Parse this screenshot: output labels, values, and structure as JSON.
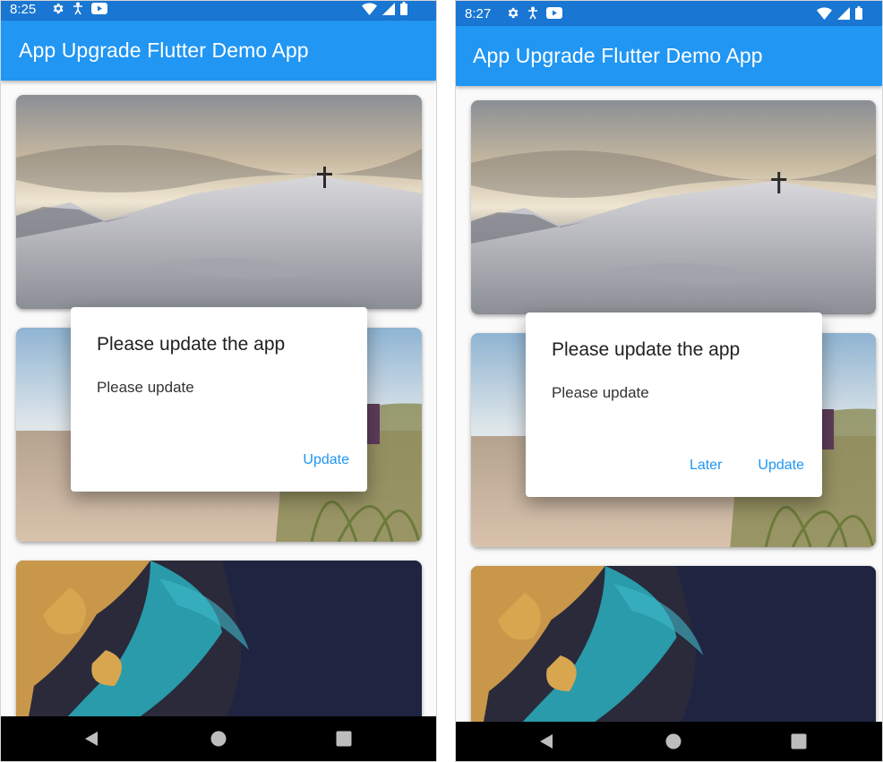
{
  "screens": [
    {
      "status": {
        "time": "8:25"
      },
      "app_bar": {
        "title": "App Upgrade Flutter Demo App"
      },
      "cards": [
        {
          "image": "snowy-hill-with-cross-photo"
        },
        {
          "image": "beach-dunes-photo"
        },
        {
          "image": "aerial-coastline-photo"
        }
      ],
      "dialog": {
        "title": "Please update the app",
        "body": "Please update",
        "buttons": {
          "update": "Update"
        }
      }
    },
    {
      "status": {
        "time": "8:27"
      },
      "app_bar": {
        "title": "App Upgrade Flutter Demo App"
      },
      "cards": [
        {
          "image": "snowy-hill-with-cross-photo"
        },
        {
          "image": "beach-dunes-photo"
        },
        {
          "image": "aerial-coastline-photo"
        }
      ],
      "dialog": {
        "title": "Please update the app",
        "body": "Please update",
        "buttons": {
          "later": "Later",
          "update": "Update"
        }
      }
    }
  ],
  "icons": {
    "status_left": [
      "settings-icon",
      "accessibility-icon",
      "youtube-icon"
    ],
    "status_right": [
      "wifi-icon",
      "signal-icon",
      "battery-icon"
    ],
    "nav": [
      "back-icon",
      "home-icon",
      "recents-icon"
    ]
  },
  "colors": {
    "status_bar": "#1976d2",
    "app_bar": "#2196f3",
    "accent": "#2196f3",
    "nav_bar": "#000000"
  }
}
